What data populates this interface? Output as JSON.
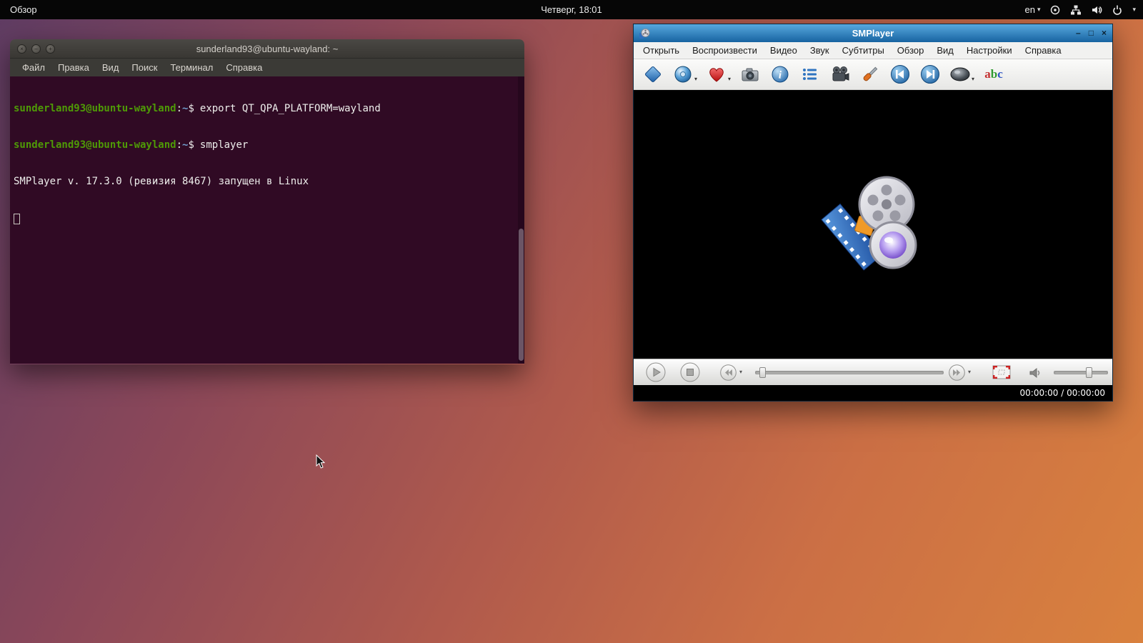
{
  "top_bar": {
    "activities_label": "Обзор",
    "clock": "Четверг, 18:01",
    "language": "en",
    "chevron": "▾"
  },
  "terminal": {
    "title": "sunderland93@ubuntu-wayland: ~",
    "window_controls": {
      "close": "×",
      "minimize": "–",
      "maximize": "+"
    },
    "menu": [
      "Файл",
      "Правка",
      "Вид",
      "Поиск",
      "Терминал",
      "Справка"
    ],
    "prompt": {
      "user_host": "sunderland93@ubuntu-wayland",
      "separator": ":",
      "path": "~",
      "symbol": "$"
    },
    "commands": [
      "export QT_QPA_PLATFORM=wayland",
      "smplayer"
    ],
    "output": "SMPlayer v. 17.3.0 (ревизия 8467) запущен в Linux"
  },
  "smplayer": {
    "title": "SMPlayer",
    "window_controls": {
      "minimize": "–",
      "maximize": "□",
      "close": "×"
    },
    "menu": [
      "Открыть",
      "Воспроизвести",
      "Видео",
      "Звук",
      "Субтитры",
      "Обзор",
      "Вид",
      "Настройки",
      "Справка"
    ],
    "toolbar_icons": [
      "open",
      "dvd",
      "favorites",
      "screenshot",
      "info",
      "playlist",
      "video",
      "preferences",
      "previous",
      "next",
      "equalizer",
      "subtitles"
    ],
    "dropdown_arrow": "▾",
    "abc": {
      "a": "a",
      "b": "b",
      "c": "c"
    },
    "status_time": "00:00:00 / 00:00:00",
    "colors": {
      "titlebar_top": "#58a9de",
      "titlebar_bottom": "#1763a1",
      "accent_blue": "#2f6fc0",
      "heart_red": "#c01818"
    }
  },
  "background": {
    "gradient_start": "#5f3c63",
    "gradient_mid": "#b05a4c",
    "gradient_end": "#d9813e"
  }
}
